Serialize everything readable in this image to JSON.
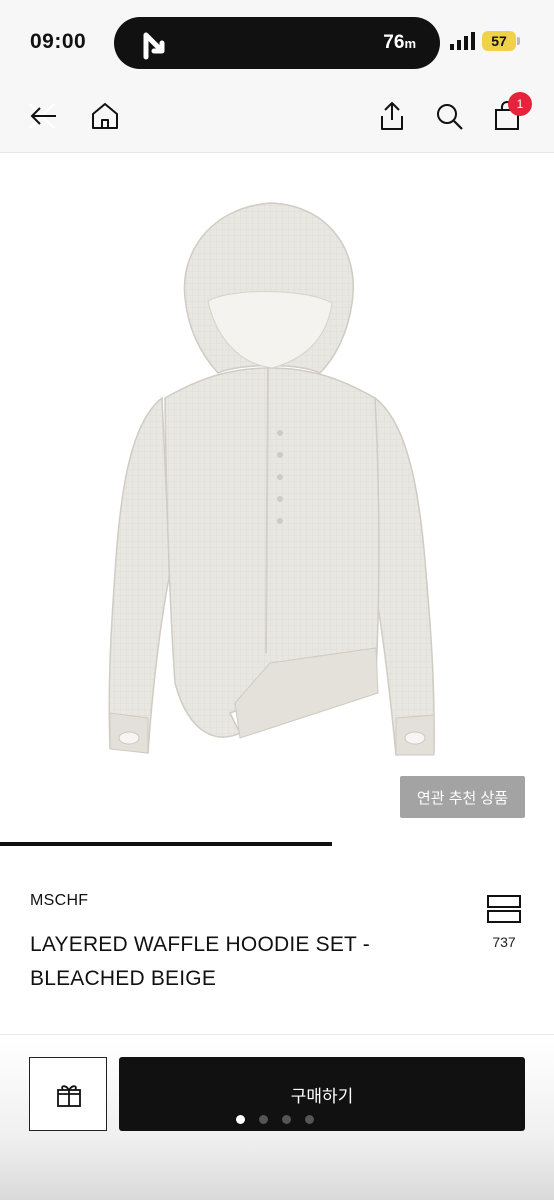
{
  "status": {
    "time": "09:00",
    "nav_distance": "76",
    "nav_distance_unit": "m",
    "battery": "57",
    "battery_color": "#f0d24a"
  },
  "header": {
    "icons": [
      "close-back-icon",
      "home-icon",
      "share-icon",
      "search-icon",
      "cart-icon"
    ],
    "cart_badge": "1",
    "badge_color": "#e5243b"
  },
  "product": {
    "image": "waffle-hoodie-photo",
    "related_button": "연관 추천 상품",
    "gallery_progress": 0.6
  },
  "info": {
    "brand": "MSCHF",
    "title_line1": "LAYERED WAFFLE HOODIE SET -",
    "title_line2": "BLEACHED BEIGE",
    "like_count": "737"
  },
  "actions": {
    "buy_label": "구매하기",
    "page_dots": 4,
    "active_dot": 1
  }
}
